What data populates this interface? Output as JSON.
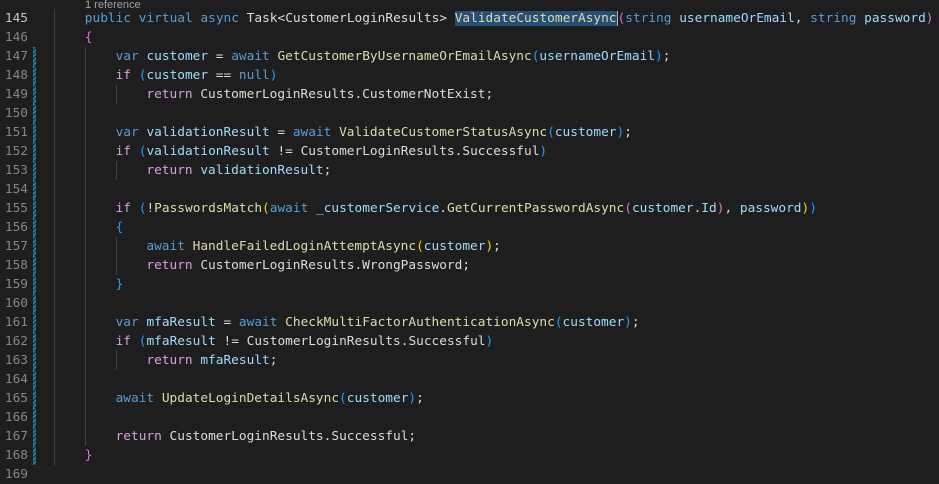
{
  "editor": {
    "codelens": "1 reference",
    "current_line": 145,
    "lines": [
      {
        "n": 145,
        "indent": 1,
        "chg": false,
        "tokens": [
          [
            "public",
            "kw"
          ],
          [
            " ",
            "txt"
          ],
          [
            "virtual",
            "kw"
          ],
          [
            " ",
            "txt"
          ],
          [
            "async",
            "kw"
          ],
          [
            " ",
            "txt"
          ],
          [
            "Task",
            "type"
          ],
          [
            "<",
            "txt"
          ],
          [
            "CustomerLoginResults",
            "type"
          ],
          [
            "> ",
            "txt"
          ],
          [
            "ValidateCustomerAsync",
            "fn sel caret"
          ],
          [
            "(",
            "b1"
          ],
          [
            "string",
            "kw"
          ],
          [
            " ",
            "txt"
          ],
          [
            "usernameOrEmail",
            "var"
          ],
          [
            ", ",
            "txt"
          ],
          [
            "string",
            "kw"
          ],
          [
            " ",
            "txt"
          ],
          [
            "password",
            "var"
          ],
          [
            ")",
            "b1"
          ]
        ]
      },
      {
        "n": 146,
        "indent": 1,
        "chg": false,
        "tokens": [
          [
            "{",
            "b1"
          ]
        ]
      },
      {
        "n": 147,
        "indent": 2,
        "chg": true,
        "tokens": [
          [
            "var",
            "kw"
          ],
          [
            " ",
            "txt"
          ],
          [
            "customer",
            "var"
          ],
          [
            " = ",
            "txt"
          ],
          [
            "await",
            "kw"
          ],
          [
            " ",
            "txt"
          ],
          [
            "GetCustomerByUsernameOrEmailAsync",
            "fn"
          ],
          [
            "(",
            "b2"
          ],
          [
            "usernameOrEmail",
            "var"
          ],
          [
            ")",
            "b2"
          ],
          [
            ";",
            "txt"
          ]
        ]
      },
      {
        "n": 148,
        "indent": 2,
        "chg": true,
        "tokens": [
          [
            "if",
            "ctl"
          ],
          [
            " ",
            "txt"
          ],
          [
            "(",
            "b2"
          ],
          [
            "customer",
            "var"
          ],
          [
            " == ",
            "txt"
          ],
          [
            "null",
            "kw"
          ],
          [
            ")",
            "b2"
          ]
        ]
      },
      {
        "n": 149,
        "indent": 3,
        "chg": true,
        "tokens": [
          [
            "return",
            "ctl"
          ],
          [
            " ",
            "txt"
          ],
          [
            "CustomerLoginResults",
            "type"
          ],
          [
            ".",
            "txt"
          ],
          [
            "CustomerNotExist",
            "type"
          ],
          [
            ";",
            "txt"
          ]
        ]
      },
      {
        "n": 150,
        "indent": 2,
        "chg": true,
        "tokens": []
      },
      {
        "n": 151,
        "indent": 2,
        "chg": true,
        "tokens": [
          [
            "var",
            "kw"
          ],
          [
            " ",
            "txt"
          ],
          [
            "validationResult",
            "var"
          ],
          [
            " = ",
            "txt"
          ],
          [
            "await",
            "kw"
          ],
          [
            " ",
            "txt"
          ],
          [
            "ValidateCustomerStatusAsync",
            "fn"
          ],
          [
            "(",
            "b2"
          ],
          [
            "customer",
            "var"
          ],
          [
            ")",
            "b2"
          ],
          [
            ";",
            "txt"
          ]
        ]
      },
      {
        "n": 152,
        "indent": 2,
        "chg": true,
        "tokens": [
          [
            "if",
            "ctl"
          ],
          [
            " ",
            "txt"
          ],
          [
            "(",
            "b2"
          ],
          [
            "validationResult",
            "var"
          ],
          [
            " != ",
            "txt"
          ],
          [
            "CustomerLoginResults",
            "type"
          ],
          [
            ".",
            "txt"
          ],
          [
            "Successful",
            "type"
          ],
          [
            ")",
            "b2"
          ]
        ]
      },
      {
        "n": 153,
        "indent": 3,
        "chg": true,
        "tokens": [
          [
            "return",
            "ctl"
          ],
          [
            " ",
            "txt"
          ],
          [
            "validationResult",
            "var"
          ],
          [
            ";",
            "txt"
          ]
        ]
      },
      {
        "n": 154,
        "indent": 2,
        "chg": true,
        "tokens": []
      },
      {
        "n": 155,
        "indent": 2,
        "chg": true,
        "tokens": [
          [
            "if",
            "ctl"
          ],
          [
            " ",
            "txt"
          ],
          [
            "(",
            "b2"
          ],
          [
            "!",
            "txt"
          ],
          [
            "PasswordsMatch",
            "fn"
          ],
          [
            "(",
            "b3"
          ],
          [
            "await",
            "kw"
          ],
          [
            " ",
            "txt"
          ],
          [
            "_customerService",
            "var"
          ],
          [
            ".",
            "txt"
          ],
          [
            "GetCurrentPasswordAsync",
            "fn"
          ],
          [
            "(",
            "b1"
          ],
          [
            "customer",
            "var"
          ],
          [
            ".",
            "txt"
          ],
          [
            "Id",
            "var"
          ],
          [
            ")",
            "b1"
          ],
          [
            ", ",
            "txt"
          ],
          [
            "password",
            "var"
          ],
          [
            ")",
            "b3"
          ],
          [
            ")",
            "b2"
          ]
        ]
      },
      {
        "n": 156,
        "indent": 2,
        "chg": true,
        "tokens": [
          [
            "{",
            "b2"
          ]
        ]
      },
      {
        "n": 157,
        "indent": 3,
        "chg": true,
        "tokens": [
          [
            "await",
            "kw"
          ],
          [
            " ",
            "txt"
          ],
          [
            "HandleFailedLoginAttemptAsync",
            "fn"
          ],
          [
            "(",
            "b3"
          ],
          [
            "customer",
            "var"
          ],
          [
            ")",
            "b3"
          ],
          [
            ";",
            "txt"
          ]
        ]
      },
      {
        "n": 158,
        "indent": 3,
        "chg": true,
        "tokens": [
          [
            "return",
            "ctl"
          ],
          [
            " ",
            "txt"
          ],
          [
            "CustomerLoginResults",
            "type"
          ],
          [
            ".",
            "txt"
          ],
          [
            "WrongPassword",
            "type"
          ],
          [
            ";",
            "txt"
          ]
        ]
      },
      {
        "n": 159,
        "indent": 2,
        "chg": true,
        "tokens": [
          [
            "}",
            "b2"
          ]
        ]
      },
      {
        "n": 160,
        "indent": 2,
        "chg": true,
        "tokens": []
      },
      {
        "n": 161,
        "indent": 2,
        "chg": true,
        "tokens": [
          [
            "var",
            "kw"
          ],
          [
            " ",
            "txt"
          ],
          [
            "mfaResult",
            "var"
          ],
          [
            " = ",
            "txt"
          ],
          [
            "await",
            "kw"
          ],
          [
            " ",
            "txt"
          ],
          [
            "CheckMultiFactorAuthenticationAsync",
            "fn"
          ],
          [
            "(",
            "b2"
          ],
          [
            "customer",
            "var"
          ],
          [
            ")",
            "b2"
          ],
          [
            ";",
            "txt"
          ]
        ]
      },
      {
        "n": 162,
        "indent": 2,
        "chg": true,
        "tokens": [
          [
            "if",
            "ctl"
          ],
          [
            " ",
            "txt"
          ],
          [
            "(",
            "b2"
          ],
          [
            "mfaResult",
            "var"
          ],
          [
            " != ",
            "txt"
          ],
          [
            "CustomerLoginResults",
            "type"
          ],
          [
            ".",
            "txt"
          ],
          [
            "Successful",
            "type"
          ],
          [
            ")",
            "b2"
          ]
        ]
      },
      {
        "n": 163,
        "indent": 3,
        "chg": true,
        "tokens": [
          [
            "return",
            "ctl"
          ],
          [
            " ",
            "txt"
          ],
          [
            "mfaResult",
            "var"
          ],
          [
            ";",
            "txt"
          ]
        ]
      },
      {
        "n": 164,
        "indent": 2,
        "chg": true,
        "tokens": []
      },
      {
        "n": 165,
        "indent": 2,
        "chg": true,
        "tokens": [
          [
            "await",
            "kw"
          ],
          [
            " ",
            "txt"
          ],
          [
            "UpdateLoginDetailsAsync",
            "fn"
          ],
          [
            "(",
            "b2"
          ],
          [
            "customer",
            "var"
          ],
          [
            ")",
            "b2"
          ],
          [
            ";",
            "txt"
          ]
        ]
      },
      {
        "n": 166,
        "indent": 2,
        "chg": true,
        "tokens": []
      },
      {
        "n": 167,
        "indent": 2,
        "chg": true,
        "tokens": [
          [
            "return",
            "ctl"
          ],
          [
            " ",
            "txt"
          ],
          [
            "CustomerLoginResults",
            "type"
          ],
          [
            ".",
            "txt"
          ],
          [
            "Successful",
            "type"
          ],
          [
            ";",
            "txt"
          ]
        ]
      },
      {
        "n": 168,
        "indent": 1,
        "chg": true,
        "tokens": [
          [
            "}",
            "b1"
          ]
        ]
      },
      {
        "n": 169,
        "indent": 0,
        "chg": false,
        "tokens": []
      }
    ]
  }
}
